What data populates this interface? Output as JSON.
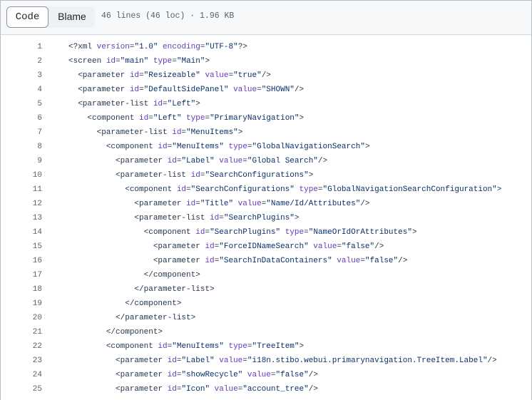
{
  "toolbar": {
    "code_label": "Code",
    "blame_label": "Blame",
    "file_info": "46 lines (46 loc) · 1.96 KB"
  },
  "colors": {
    "tag": "#24364e",
    "attr": "#6639ba",
    "string": "#0a3069"
  },
  "code_lines": [
    {
      "n": "1",
      "text": "<?xml version=\"1.0\" encoding=\"UTF-8\"?>"
    },
    {
      "n": "2",
      "text": "<screen id=\"main\" type=\"Main\">"
    },
    {
      "n": "3",
      "text": "  <parameter id=\"Resizeable\" value=\"true\"/>"
    },
    {
      "n": "4",
      "text": "  <parameter id=\"DefaultSidePanel\" value=\"SHOWN\"/>"
    },
    {
      "n": "5",
      "text": "  <parameter-list id=\"Left\">"
    },
    {
      "n": "6",
      "text": "    <component id=\"Left\" type=\"PrimaryNavigation\">"
    },
    {
      "n": "7",
      "text": "      <parameter-list id=\"MenuItems\">"
    },
    {
      "n": "8",
      "text": "        <component id=\"MenuItems\" type=\"GlobalNavigationSearch\">"
    },
    {
      "n": "9",
      "text": "          <parameter id=\"Label\" value=\"Global Search\"/>"
    },
    {
      "n": "10",
      "text": "          <parameter-list id=\"SearchConfigurations\">"
    },
    {
      "n": "11",
      "text": "            <component id=\"SearchConfigurations\" type=\"GlobalNavigationSearchConfiguration\">"
    },
    {
      "n": "12",
      "text": "              <parameter id=\"Title\" value=\"Name/Id/Attributes\"/>"
    },
    {
      "n": "13",
      "text": "              <parameter-list id=\"SearchPlugins\">"
    },
    {
      "n": "14",
      "text": "                <component id=\"SearchPlugins\" type=\"NameOrIdOrAttributes\">"
    },
    {
      "n": "15",
      "text": "                  <parameter id=\"ForceIDNameSearch\" value=\"false\"/>"
    },
    {
      "n": "16",
      "text": "                  <parameter id=\"SearchInDataContainers\" value=\"false\"/>"
    },
    {
      "n": "17",
      "text": "                </component>"
    },
    {
      "n": "18",
      "text": "              </parameter-list>"
    },
    {
      "n": "19",
      "text": "            </component>"
    },
    {
      "n": "20",
      "text": "          </parameter-list>"
    },
    {
      "n": "21",
      "text": "        </component>"
    },
    {
      "n": "22",
      "text": "        <component id=\"MenuItems\" type=\"TreeItem\">"
    },
    {
      "n": "23",
      "text": "          <parameter id=\"Label\" value=\"i18n.stibo.webui.primarynavigation.TreeItem.Label\"/>"
    },
    {
      "n": "24",
      "text": "          <parameter id=\"showRecycle\" value=\"false\"/>"
    },
    {
      "n": "25",
      "text": "          <parameter id=\"Icon\" value=\"account_tree\"/>"
    }
  ]
}
